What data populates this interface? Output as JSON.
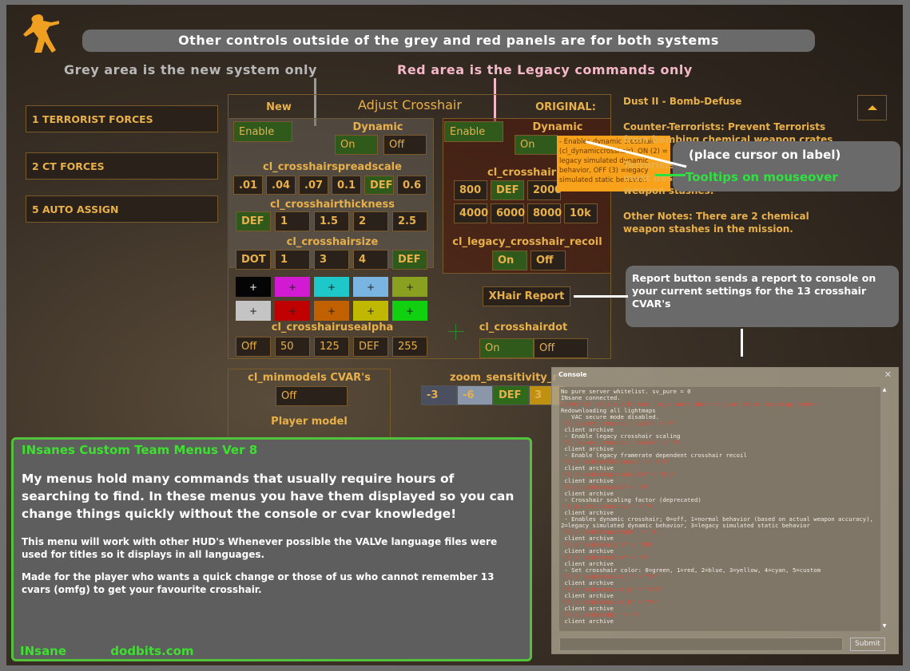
{
  "banner": "Other controls outside of the grey and red panels are for both systems",
  "grey_note": "Grey area is the new system only",
  "red_note": "Red area is the Legacy commands only",
  "teams": [
    "1 TERRORIST FORCES",
    "2 CT FORCES",
    "5 AUTO ASSIGN"
  ],
  "panel": {
    "title": "Adjust Crosshair",
    "new_label": "New",
    "original_label": "ORIGINAL:"
  },
  "new_system": {
    "enable": "Enable",
    "dynamic_label": "Dynamic",
    "dynamic": [
      "On",
      "Off"
    ],
    "spreadscale_label": "cl_crosshairspreadscale",
    "spreadscale": [
      ".01",
      ".04",
      ".07",
      "0.1",
      "DEF",
      "0.6"
    ],
    "thickness_label": "cl_crosshairthickness",
    "thickness": [
      "DEF",
      "1",
      "1.5",
      "2",
      "2.5"
    ],
    "size_label": "cl_crosshairsize",
    "size": [
      "DOT",
      "1",
      "3",
      "4",
      "DEF"
    ]
  },
  "colors": {
    "swatch_glyph": "+",
    "row1": [
      "#050505",
      "#d21ad2",
      "#1fc8c8",
      "#7ab4e0",
      "#8aa020"
    ],
    "row2": [
      "#c4c4c4",
      "#c00000",
      "#c06000",
      "#c0b800",
      "#10d010"
    ]
  },
  "usealpha": {
    "label": "cl_crosshairusealpha",
    "values": [
      "Off",
      "50",
      "125",
      "DEF",
      "255"
    ]
  },
  "legacy": {
    "enable": "Enable",
    "dynamic_label": "Dynamic",
    "dynamic_on": "On",
    "scale_label": "cl_crosshairs",
    "scale_row1": [
      "800",
      "DEF",
      "2000"
    ],
    "scale_row2": [
      "4000",
      "6000",
      "8000",
      "10k"
    ],
    "recoil_label": "cl_legacy_crosshair_recoil",
    "recoil": [
      "On",
      "Off"
    ]
  },
  "tooltip": "- Enables dynamic crosshair (cl_dynamiccrosshair). ON (2) = legacy simulated dynamic behavior, OFF (3) =legacy simulated static behavior.",
  "xhair_report": "XHair Report",
  "crosshairdot": {
    "label": "cl_crosshairdot",
    "values": [
      "On",
      "Off"
    ]
  },
  "minmodels": {
    "label": "cl_minmodels CVAR's",
    "value": "Off",
    "player_model": "Player model"
  },
  "zoom": {
    "label": "zoom_sensitivity_r",
    "values": [
      "-3",
      "-6",
      "DEF",
      "3"
    ]
  },
  "mission": {
    "title": "Dust II - Bomb-Defuse",
    "ct": "Counter-Terrorists: Prevent Terrorists from bombing chemical weapon crates",
    "t": "Terrorists: The Terrorist carrying the C4 must destroy one of the chemical weapon stashes.",
    "notes": "Other Notes: There are 2 chemical weapon stashes in the mission."
  },
  "callouts": {
    "cursor": "(place cursor on label)",
    "tooltips": "Tooltips on mouseover",
    "report": "Report button sends a report to console on your current settings for the 13 crosshair CVAR's"
  },
  "info": {
    "title": "INsanes Custom Team Menus Ver 8",
    "p1": "My menus hold many commands that usually require hours of  searching to find. In these menus you have them displayed so you can change things quickly without the console or cvar knowledge!",
    "p2": "This menu will work with other HUD's Whenever possible the VALVe language files were used for titles  so it displays in all languages.",
    "p3": "Made for the player who wants a quick change or those of us who cannot remember 13 cvars (omfg)  to get your favourite crosshair.",
    "author": "INsane",
    "site": "dodbits.com"
  },
  "console": {
    "title": "Console",
    "submit": "Submit",
    "input": "",
    "lines": [
      {
        "t": "No pure server whitelist. sv_pure = 0"
      },
      {
        "t": "INsane connected."
      },
      {
        "t": "ConVarRef cl_cloud_browser_on_connect doesn't point to an existing ConVar",
        "red": true
      },
      {
        "t": "Redownloading all lightmaps"
      },
      {
        "t": "   VAC secure mode disabled."
      },
      {
        "t": "\"cl_legacy_crosshair_scale\" = \"0\"",
        "red": true
      },
      {
        "t": " client archive"
      },
      {
        "t": " - Enable legacy crosshair scaling"
      },
      {
        "t": "\"cl_legacy_crosshair_recoil\" = \"0\"",
        "red": true
      },
      {
        "t": " client archive"
      },
      {
        "t": " - Enable legacy framerate dependent crosshair recoil"
      },
      {
        "t": "\"cl_crosshairthickness\" = \"0.5\"",
        "red": true
      },
      {
        "t": " client archive"
      },
      {
        "t": "\"cl_crosshairspreadscale\" = \"0.3\"",
        "red": true
      },
      {
        "t": " client archive"
      },
      {
        "t": "\"cl_crosshairscale\" = \"0\"",
        "red": true
      },
      {
        "t": " client archive"
      },
      {
        "t": " - Crosshair scaling factor (deprecated)"
      },
      {
        "t": "\"cl_dynamiccrosshair\" = \"3\"",
        "red": true
      },
      {
        "t": " client archive"
      },
      {
        "t": " - Enables dynamic crosshair; 0=off, 1=normal behavior (based on actual weapon accuracy),"
      },
      {
        "t": "2=legacy simulated dynamic behavior, 3=legacy simulated static behavior"
      },
      {
        "t": "\"cl_crosshairusealpha\" = \"1\"",
        "red": true
      },
      {
        "t": " client archive"
      },
      {
        "t": "\"cl_crosshairalpha\" = \"200\"",
        "red": true
      },
      {
        "t": " client archive"
      },
      {
        "t": "\"cl_crosshaircolor\" = \"5\"",
        "red": true
      },
      {
        "t": " client archive"
      },
      {
        "t": " - Set crosshair color: 0=green, 1=red, 2=blue, 3=yellow, 4=cyan, 5=custom"
      },
      {
        "t": "\"cl_crosshaircolor_r\" = \"50\"",
        "red": true
      },
      {
        "t": " client archive"
      },
      {
        "t": "\"cl_crosshaircolor_g\" = \"250\"",
        "red": true
      },
      {
        "t": " client archive"
      },
      {
        "t": "\"cl_crosshaircolor_b\" = \"50\"",
        "red": true
      },
      {
        "t": " client archive"
      },
      {
        "t": "\"cl_crosshairdot\" = \"0\"",
        "red": true
      },
      {
        "t": " client archive"
      }
    ]
  },
  "accent": {
    "gold": "#e8b04a",
    "selected_green": "#2f5a1c",
    "tooltip_orange": "#f7a21a",
    "info_border": "#52c23a"
  }
}
